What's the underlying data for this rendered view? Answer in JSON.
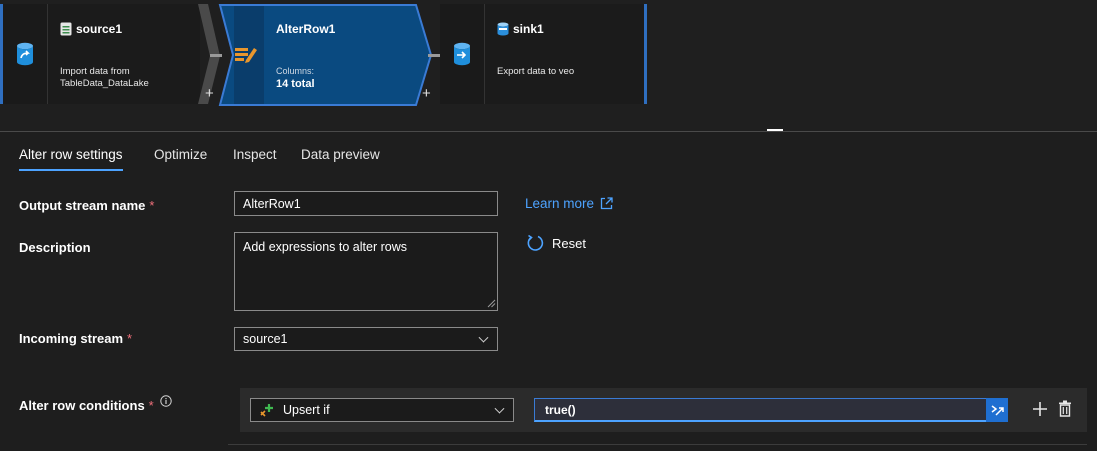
{
  "flow": {
    "source": {
      "title": "source1",
      "description": "Import data from TableData_DataLake"
    },
    "alter": {
      "title": "AlterRow1",
      "columns_label": "Columns:",
      "columns_value": "14 total"
    },
    "sink": {
      "title": "sink1",
      "description": "Export data to veo"
    },
    "plus_symbol": "+"
  },
  "tabs": [
    {
      "label": "Alter row settings",
      "active": true
    },
    {
      "label": "Optimize",
      "active": false
    },
    {
      "label": "Inspect",
      "active": false
    },
    {
      "label": "Data preview",
      "active": false
    }
  ],
  "form": {
    "required_mark": "*",
    "output_stream": {
      "label": "Output stream name",
      "value": "AlterRow1"
    },
    "description": {
      "label": "Description",
      "value": "Add expressions to alter rows"
    },
    "incoming_stream": {
      "label": "Incoming stream",
      "value": "source1"
    },
    "conditions": {
      "label": "Alter row conditions",
      "type_value": "Upsert if",
      "expression_value": "true()"
    },
    "learn_more": "Learn more",
    "reset": "Reset"
  },
  "colors": {
    "accent": "#4da3ff",
    "node_selected": "#0a4a80",
    "node_border": "#3a7bd5",
    "required": "#f1707b"
  }
}
